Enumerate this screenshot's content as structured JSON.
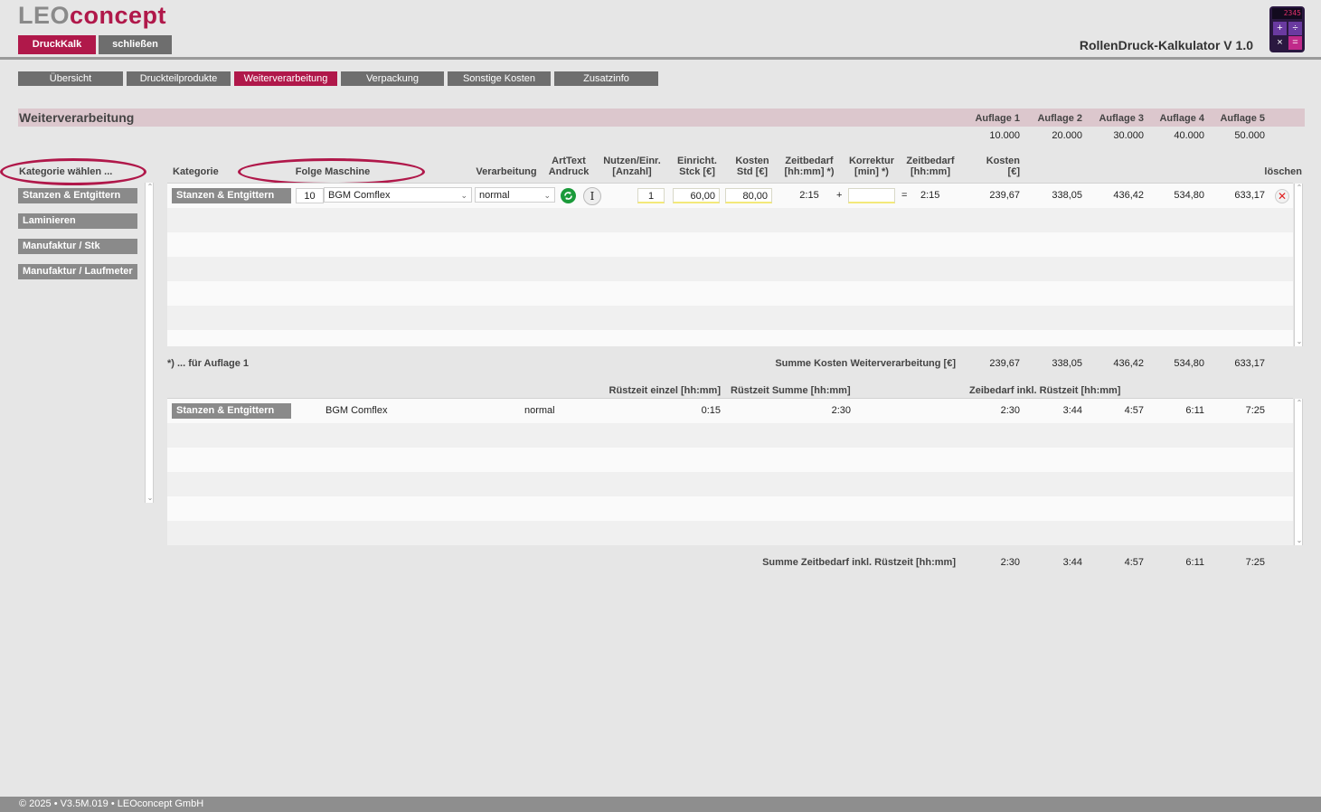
{
  "brand": {
    "logo_part1": "LEO",
    "logo_part2": "concept",
    "app_title": "RollenDruck-Kalkulator V 1.0",
    "icon_display": "2345"
  },
  "top_buttons": {
    "druckkalk": "DruckKalk",
    "schliessen": "schließen"
  },
  "tabs": [
    "Übersicht",
    "Druckteilprodukte",
    "Weiterverarbeitung",
    "Verpackung",
    "Sonstige Kosten",
    "Zusatzinfo"
  ],
  "active_tab": "Weiterverarbeitung",
  "section": {
    "title": "Weiterverarbeitung",
    "auflagen": [
      "Auflage 1",
      "Auflage 2",
      "Auflage 3",
      "Auflage 4",
      "Auflage 5"
    ],
    "auflage_values": [
      "10.000",
      "20.000",
      "30.000",
      "40.000",
      "50.000"
    ]
  },
  "categories": {
    "header": "Kategorie wählen ...",
    "items": [
      "Stanzen & Entgittern",
      "Laminieren",
      "Manufaktur / Stk",
      "Manufaktur / Laufmeter"
    ]
  },
  "columns": {
    "kategorie": "Kategorie",
    "folge_maschine": "Folge Maschine",
    "verarbeitung": "Verarbeitung",
    "arttext_1": "ArtText",
    "arttext_2": "Andruck",
    "nutzen_1": "Nutzen/Einr.",
    "nutzen_2": "[Anzahl]",
    "einricht_1": "Einricht.",
    "einricht_2": "Stck [€]",
    "kosten_std_1": "Kosten",
    "kosten_std_2": "Std [€]",
    "zeitbedarf_1": "Zeitbedarf",
    "zeitbedarf_2": "[hh:mm] *)",
    "korrektur_1": "Korrektur",
    "korrektur_2": "[min] *)",
    "zeitbedarf_b_1": "Zeitbedarf",
    "zeitbedarf_b_2": "[hh:mm]",
    "kosten_1": "Kosten",
    "kosten_2": "[€]",
    "loeschen": "löschen"
  },
  "main_row": {
    "kategorie": "Stanzen & Entgittern",
    "folge": "10",
    "maschine": "BGM Comflex",
    "verarbeitung": "normal",
    "nutzen": "1",
    "einricht": "60,00",
    "kosten_std": "80,00",
    "zeitbedarf": "2:15",
    "plus": "+",
    "korrektur": "",
    "equals": "=",
    "zeitbedarf_total": "2:15",
    "kosten": [
      "239,67",
      "338,05",
      "436,42",
      "534,80",
      "633,17"
    ]
  },
  "summary1": {
    "note": "*) ... für Auflage 1",
    "label": "Summe Kosten Weiterverarbeitung [€]",
    "values": [
      "239,67",
      "338,05",
      "436,42",
      "534,80",
      "633,17"
    ]
  },
  "ruest": {
    "h_einzel": "Rüstzeit einzel [hh:mm]",
    "h_summe": "Rüstzeit Summe [hh:mm]",
    "h_zeibedarf": "Zeibedarf inkl. Rüstzeit [hh:mm]",
    "row": {
      "kategorie": "Stanzen & Entgittern",
      "maschine": "BGM Comflex",
      "verarbeitung": "normal",
      "einzel": "0:15",
      "summe": "2:30",
      "values": [
        "2:30",
        "3:44",
        "4:57",
        "6:11",
        "7:25"
      ]
    }
  },
  "summary2": {
    "label": "Summe Zeitbedarf inkl. Rüstzeit [hh:mm]",
    "values": [
      "2:30",
      "3:44",
      "4:57",
      "6:11",
      "7:25"
    ]
  },
  "footer": {
    "text": "© 2025 • V3.5M.019 • LEOconcept GmbH"
  }
}
